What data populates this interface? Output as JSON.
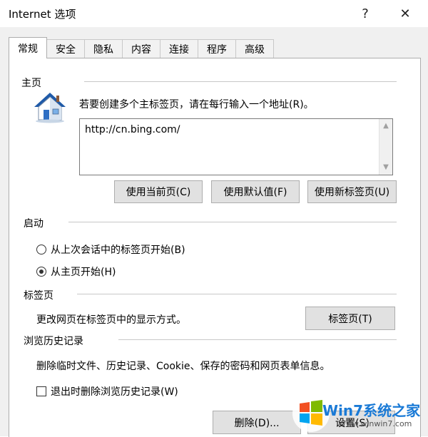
{
  "window": {
    "title": "Internet 选项",
    "help_glyph": "?",
    "close_glyph": "✕"
  },
  "tabs": [
    {
      "label": "常规",
      "active": true
    },
    {
      "label": "安全"
    },
    {
      "label": "隐私"
    },
    {
      "label": "内容"
    },
    {
      "label": "连接"
    },
    {
      "label": "程序"
    },
    {
      "label": "高级"
    }
  ],
  "homepage": {
    "group_label": "主页",
    "hint": "若要创建多个主标签页，请在每行输入一个地址(R)。",
    "url": "http://cn.bing.com/",
    "buttons": {
      "use_current": "使用当前页(C)",
      "use_default": "使用默认值(F)",
      "use_new_tab": "使用新标签页(U)"
    }
  },
  "startup": {
    "group_label": "启动",
    "options": [
      {
        "label": "从上次会话中的标签页开始(B)",
        "checked": false
      },
      {
        "label": "从主页开始(H)",
        "checked": true
      }
    ]
  },
  "tabs_section": {
    "group_label": "标签页",
    "description": "更改网页在标签页中的显示方式。",
    "button": "标签页(T)"
  },
  "history": {
    "group_label": "浏览历史记录",
    "description": "删除临时文件、历史记录、Cookie、保存的密码和网页表单信息。",
    "checkbox_label": "退出时删除浏览历史记录(W)",
    "checkbox_checked": false,
    "delete_button": "删除(D)...",
    "settings_button": "设置(S)"
  },
  "watermark": {
    "brand": "Win7系统之家",
    "url": "Www.winwin7.com"
  },
  "icons": {
    "homepage": "house-icon",
    "help": "help-icon",
    "close": "close-icon",
    "scroll_up": "scroll-up-arrow-icon",
    "scroll_down": "scroll-down-arrow-icon",
    "watermark_logo": "windows-logo-icon"
  },
  "colors": {
    "dialog_bg": "#f0f0f0",
    "button_bg": "#e1e1e1",
    "border": "#adadad",
    "accent_house": "#2f6fc4"
  }
}
